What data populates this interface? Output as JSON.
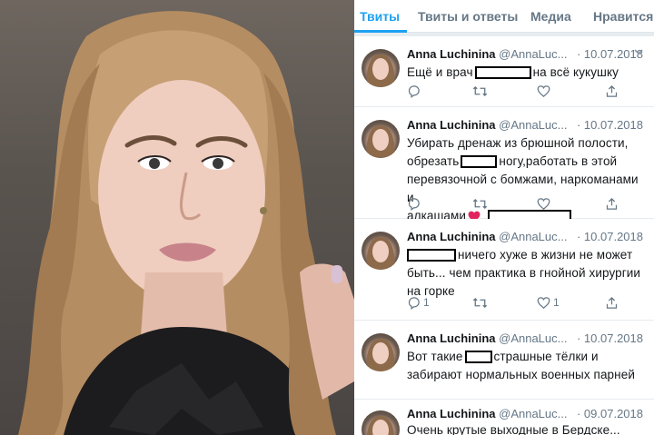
{
  "tabs": [
    {
      "label": "Твиты",
      "active": true
    },
    {
      "label": "Твиты и ответы",
      "active": false
    },
    {
      "label": "Медиа",
      "active": false
    },
    {
      "label": "Нравится",
      "active": false
    }
  ],
  "colors": {
    "accent": "#1da1f2",
    "muted": "#657786",
    "text": "#14171a",
    "heart": "#e0245e"
  },
  "tweets": [
    {
      "name": "Anna Luchinina",
      "handle": "@AnnaLuc...",
      "date": "· 10.07.2018",
      "parts": [
        "Ещё и врач",
        "на всё кукушку"
      ],
      "replies": "",
      "retweets": "",
      "likes": ""
    },
    {
      "name": "Anna Luchinina",
      "handle": "@AnnaLuc...",
      "date": "· 10.07.2018",
      "line1": "Убирать дренаж из брюшной полости,",
      "line2a": "обрезать",
      "line2b": "ногу,работать в этой",
      "line3": "перевязочной с бомжами, наркоманами и",
      "line4": "алкашами",
      "heart_emoji": "heart-emoji",
      "replies": "",
      "retweets": "",
      "likes": ""
    },
    {
      "name": "Anna Luchinina",
      "handle": "@AnnaLuc...",
      "date": "· 10.07.2018",
      "line1": "ничего хуже в жизни не может",
      "line2": "быть... чем практика в гнойной хирургии",
      "line3": "на горке",
      "replies": "1",
      "retweets": "",
      "likes": "1"
    },
    {
      "name": "Anna Luchinina",
      "handle": "@AnnaLuc...",
      "date": "· 10.07.2018",
      "line1a": "Вот такие",
      "line1b": "страшные тёлки и",
      "line2": "забирают нормальных военных парней",
      "replies": "",
      "retweets": "",
      "likes": ""
    },
    {
      "name": "Anna Luchinina",
      "handle": "@AnnaLuc...",
      "date": "· 09.07.2018",
      "line1": "Очень крутые выходные в Бердске..."
    }
  ]
}
